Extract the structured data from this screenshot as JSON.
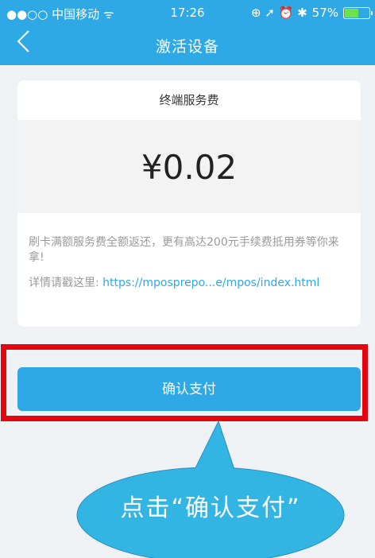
{
  "status_bar": {
    "carrier": "●●○○ 中国移动 ᯤ",
    "time": "17:26",
    "icons": "⊕ ➚ ⏰ ✱",
    "battery": "57%",
    "battery_level": 0.57
  },
  "nav": {
    "title": "激活设备",
    "back_icon": "chevron-left-icon"
  },
  "card": {
    "title": "终端服务费",
    "amount": "¥0.02",
    "promo": "刷卡满额服务费全额返还，更有高达200元手续费抵用券等你来拿!",
    "detail_label": "详情请戳这里:",
    "detail_link": "https://mposprepo...e/mpos/index.html"
  },
  "confirm_button": {
    "label": "确认支付"
  },
  "annotation": {
    "text": "点击“确认支付”"
  },
  "colors": {
    "primary": "#2ea9e6",
    "highlight": "#e3060e",
    "callout": "#33b5e3"
  }
}
